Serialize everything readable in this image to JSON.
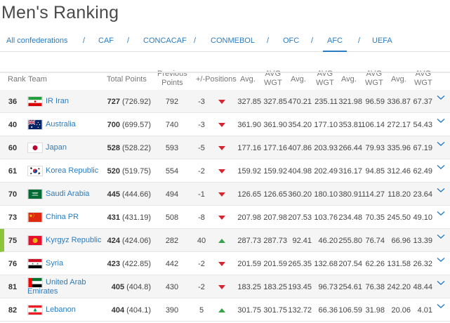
{
  "title": "Men's Ranking",
  "confederations": [
    {
      "label": "All confederations",
      "active": false
    },
    {
      "label": "CAF",
      "active": false
    },
    {
      "label": "CONCACAF",
      "active": false
    },
    {
      "label": "CONMEBOL",
      "active": false
    },
    {
      "label": "OFC",
      "active": false
    },
    {
      "label": "AFC",
      "active": true
    },
    {
      "label": "UEFA",
      "active": false
    }
  ],
  "separator": "/",
  "columns": {
    "rank": "Rank",
    "team": "Team",
    "total_points": "Total Points",
    "previous_points_1": "Previous",
    "previous_points_2": "Points",
    "positions": "+/-Positions",
    "avg": "Avg.",
    "avg_wgt_1": "AVG",
    "avg_wgt_2": "WGT"
  },
  "colors": {
    "accent": "#2b7cc0",
    "down": "#d9232d",
    "up": "#3aa34a",
    "highlight": "#8cc43a"
  },
  "rows": [
    {
      "rank": "36",
      "team": "IR Iran",
      "flag": "iran-flag-icon",
      "pts": "727",
      "pts_exact": "(726.92)",
      "prev": "792",
      "diff": "-3",
      "trend": "down",
      "vals": [
        "327.85",
        "327.85",
        "470.21",
        "235.11",
        "321.98",
        "96.59",
        "336.87",
        "67.37"
      ]
    },
    {
      "rank": "40",
      "team": "Australia",
      "flag": "australia-flag-icon",
      "pts": "700",
      "pts_exact": "(699.57)",
      "prev": "740",
      "diff": "-3",
      "trend": "down",
      "vals": [
        "361.90",
        "361.90",
        "354.20",
        "177.10",
        "353.81",
        "106.14",
        "272.17",
        "54.43"
      ]
    },
    {
      "rank": "60",
      "team": "Japan",
      "flag": "japan-flag-icon",
      "pts": "528",
      "pts_exact": "(528.22)",
      "prev": "593",
      "diff": "-5",
      "trend": "down",
      "vals": [
        "177.16",
        "177.16",
        "407.86",
        "203.93",
        "266.44",
        "79.93",
        "335.96",
        "67.19"
      ]
    },
    {
      "rank": "61",
      "team": "Korea Republic",
      "flag": "korea-flag-icon",
      "pts": "520",
      "pts_exact": "(519.75)",
      "prev": "554",
      "diff": "-2",
      "trend": "down",
      "vals": [
        "159.92",
        "159.92",
        "404.98",
        "202.49",
        "316.17",
        "94.85",
        "312.46",
        "62.49"
      ]
    },
    {
      "rank": "70",
      "team": "Saudi Arabia",
      "flag": "saudi-flag-icon",
      "pts": "445",
      "pts_exact": "(444.66)",
      "prev": "494",
      "diff": "-1",
      "trend": "down",
      "vals": [
        "126.65",
        "126.65",
        "360.20",
        "180.10",
        "380.91",
        "114.27",
        "118.20",
        "23.64"
      ]
    },
    {
      "rank": "73",
      "team": "China PR",
      "flag": "china-flag-icon",
      "pts": "431",
      "pts_exact": "(431.19)",
      "prev": "508",
      "diff": "-8",
      "trend": "down",
      "vals": [
        "207.98",
        "207.98",
        "207.53",
        "103.76",
        "234.48",
        "70.35",
        "245.50",
        "49.10"
      ]
    },
    {
      "rank": "75",
      "team": "Kyrgyz Republic",
      "flag": "kyrgyz-flag-icon",
      "pts": "424",
      "pts_exact": "(424.06)",
      "prev": "282",
      "diff": "40",
      "trend": "up",
      "vals": [
        "287.73",
        "287.73",
        "92.41",
        "46.20",
        "255.80",
        "76.74",
        "66.96",
        "13.39"
      ]
    },
    {
      "rank": "76",
      "team": "Syria",
      "flag": "syria-flag-icon",
      "pts": "423",
      "pts_exact": "(422.85)",
      "prev": "442",
      "diff": "-2",
      "trend": "down",
      "vals": [
        "201.59",
        "201.59",
        "265.35",
        "132.68",
        "207.54",
        "62.26",
        "131.58",
        "26.32"
      ]
    },
    {
      "rank": "81",
      "team": "United Arab Emirates",
      "flag": "uae-flag-icon",
      "pts": "405",
      "pts_exact": "(404.8)",
      "prev": "430",
      "diff": "-2",
      "trend": "down",
      "vals": [
        "183.25",
        "183.25",
        "193.45",
        "96.73",
        "254.61",
        "76.38",
        "242.20",
        "48.44"
      ]
    },
    {
      "rank": "82",
      "team": "Lebanon",
      "flag": "lebanon-flag-icon",
      "pts": "404",
      "pts_exact": "(404.1)",
      "prev": "390",
      "diff": "5",
      "trend": "up",
      "vals": [
        "301.75",
        "301.75",
        "132.72",
        "66.36",
        "106.59",
        "31.98",
        "20.06",
        "4.01"
      ]
    }
  ]
}
